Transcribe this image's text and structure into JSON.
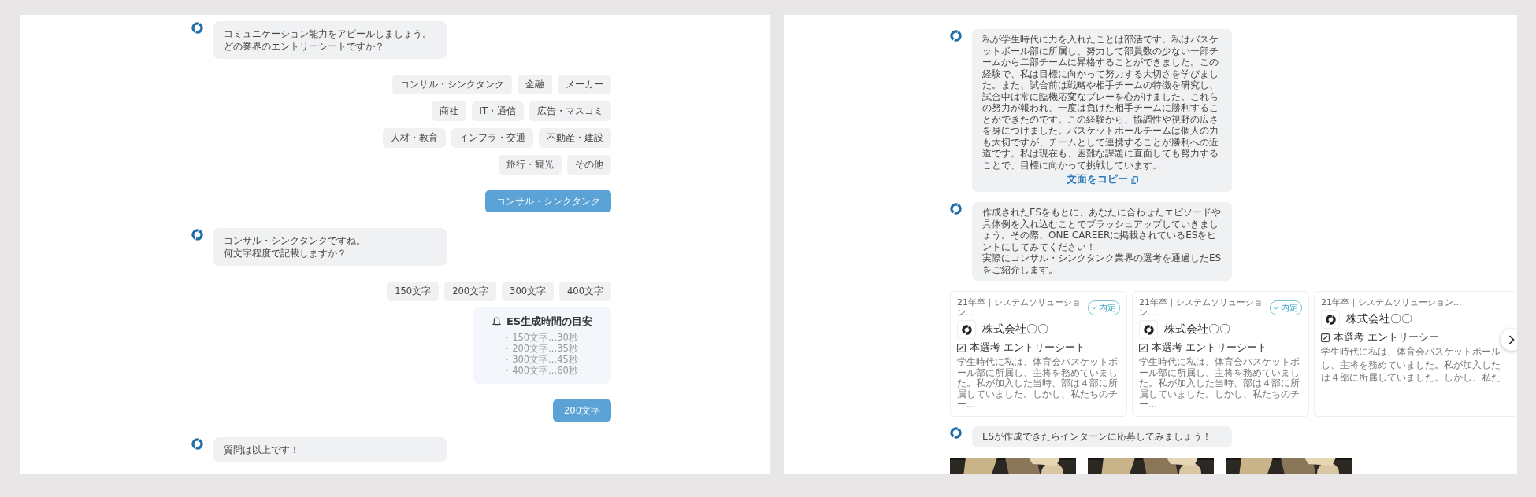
{
  "left_panel": {
    "messages": [
      {
        "kind": "bot",
        "lines": [
          "コミュニケーション能力をアピールしましょう。",
          "どの業界のエントリーシートですか？"
        ]
      },
      {
        "kind": "options",
        "option_rows": [
          [
            "コンサル・シンクタンク",
            "金融",
            "メーカー"
          ],
          [
            "商社",
            "IT・通信",
            "広告・マスコミ"
          ],
          [
            "人材・教育",
            "インフラ・交通",
            "不動産・建設"
          ],
          [
            "旅行・観光",
            "その他"
          ]
        ]
      },
      {
        "kind": "answer",
        "text": "コンサル・シンクタンク"
      },
      {
        "kind": "bot",
        "lines": [
          "コンサル・シンクタンクですね。",
          "何文字程度で記載しますか？"
        ]
      },
      {
        "kind": "options",
        "option_rows": [
          [
            "150文字",
            "200文字",
            "300文字",
            "400文字"
          ]
        ]
      },
      {
        "kind": "info",
        "title": "ES生成時間の目安",
        "items": [
          "150文字...30秒",
          "200文字...35秒",
          "300文字...45秒",
          "400文字...60秒"
        ]
      },
      {
        "kind": "answer",
        "text": "200文字"
      },
      {
        "kind": "bot",
        "lines": [
          "質問は以上です！"
        ]
      }
    ]
  },
  "right_panel": {
    "messages": [
      {
        "kind": "bot",
        "lines": [
          "私が学生時代に力を入れたことは部活です。私はバスケットボール部に所属し、努力して部員数の少ない一部チームから二部チームに昇格することができました。この経験で、私は目標に向かって努力する大切さを学びました。また、試合前は戦略や相手チームの特徴を研究し、試合中は常に臨機応変なプレーを心がけました。これらの努力が報われ、一度は負けた相手チームに勝利することができたのです。この経験から、協調性や視野の広さを身につけました。バスケットボールチームは個人の力も大切ですが、チームとして連携することが勝利への近道です。私は現在も、困難な課題に直面しても努力することで、目標に向かって挑戦しています。"
        ],
        "action": "文面をコピー"
      },
      {
        "kind": "bot",
        "lines": [
          "作成されたESをもとに、あなたに合わせたエピソードや具体例を入れ込むことでブラッシュアップしていきましょう。その際、ONE CAREERに掲載されているESをヒントにしてみてください！",
          "実際にコンサル・シンクタンク業界の選考を通過したESをご紹介します。"
        ]
      },
      {
        "kind": "cards",
        "cards": [
          {
            "meta": "21年卒｜システムソリューション...",
            "badge": "内定",
            "company": "株式会社〇〇",
            "title": "本選考 エントリーシート",
            "excerpt": "学生時代に私は、体育会バスケットボール部に所属し、主将を務めていました。私が加入した当時、部は４部に所属していました。しかし、私たちのチー..."
          },
          {
            "meta": "21年卒｜システムソリューション...",
            "badge": "内定",
            "company": "株式会社〇〇",
            "title": "本選考 エントリーシート",
            "excerpt": "学生時代に私は、体育会バスケットボール部に所属し、主将を務めていました。私が加入した当時、部は４部に所属していました。しかし、私たちのチー..."
          },
          {
            "meta": "21年卒｜システムソリューション...",
            "company": "株式会社〇〇",
            "title": "本選考 エントリーシー",
            "excerpt_lines": [
              "学生時代に私は、体育会バスケットボール",
              "し、主将を務めていました。私が加入した",
              "は４部に所属していました。しかし、私た"
            ]
          }
        ]
      },
      {
        "kind": "bot",
        "lines": [
          "ESが作成できたらインターンに応募してみましょう！"
        ]
      },
      {
        "kind": "pictures"
      }
    ]
  }
}
